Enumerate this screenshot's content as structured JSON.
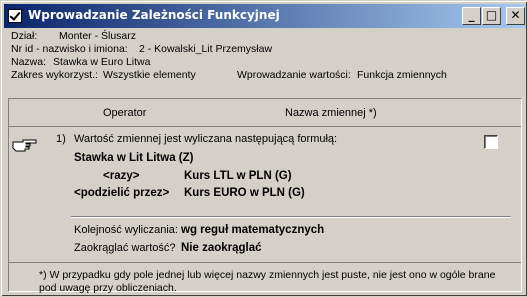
{
  "window": {
    "title": "Wprowadzanie Zależności Funkcyjnej",
    "minimize_glyph": "_",
    "maximize_glyph": "□",
    "close_glyph": "✕"
  },
  "info": {
    "dzial_label": "Dział:",
    "dzial_value": "Monter - Ślusarz",
    "nrid_label": "Nr id - nazwisko i imiona:",
    "nrid_value": "2 - Kowalski_Lit Przemysław",
    "nazwa_label": "Nazwa:",
    "nazwa_value": "Stawka w Euro Litwa",
    "zakres_label": "Zakres wykorzyst.:",
    "zakres_value": "Wszystkie elementy",
    "wprow_label": "Wprowadzanie wartości:",
    "wprow_value": "Funkcja zmiennych"
  },
  "table": {
    "col_operator": "Operator",
    "col_name": "Nazwa zmiennej *)",
    "row": {
      "index": "1)",
      "description": "Wartość zmiennej jest wyliczana następującą formułą:",
      "var1": "Stawka w Lit Litwa (Z)",
      "op2": "<razy>",
      "var2": "Kurs LTL w PLN (G)",
      "op3": "<podzielić przez>",
      "var3": "Kurs EURO w PLN (G)",
      "order_label": "Kolejność wyliczania:",
      "order_value": "wg reguł matematycznych",
      "round_label": "Zaokrąglać wartość?",
      "round_value": "Nie zaokrąglać"
    },
    "footnote": "*) W przypadku gdy pole jednej lub więcej nazwy zmiennych jest puste, nie jest ono w ogóle brane pod uwagę przy obliczeniach."
  }
}
